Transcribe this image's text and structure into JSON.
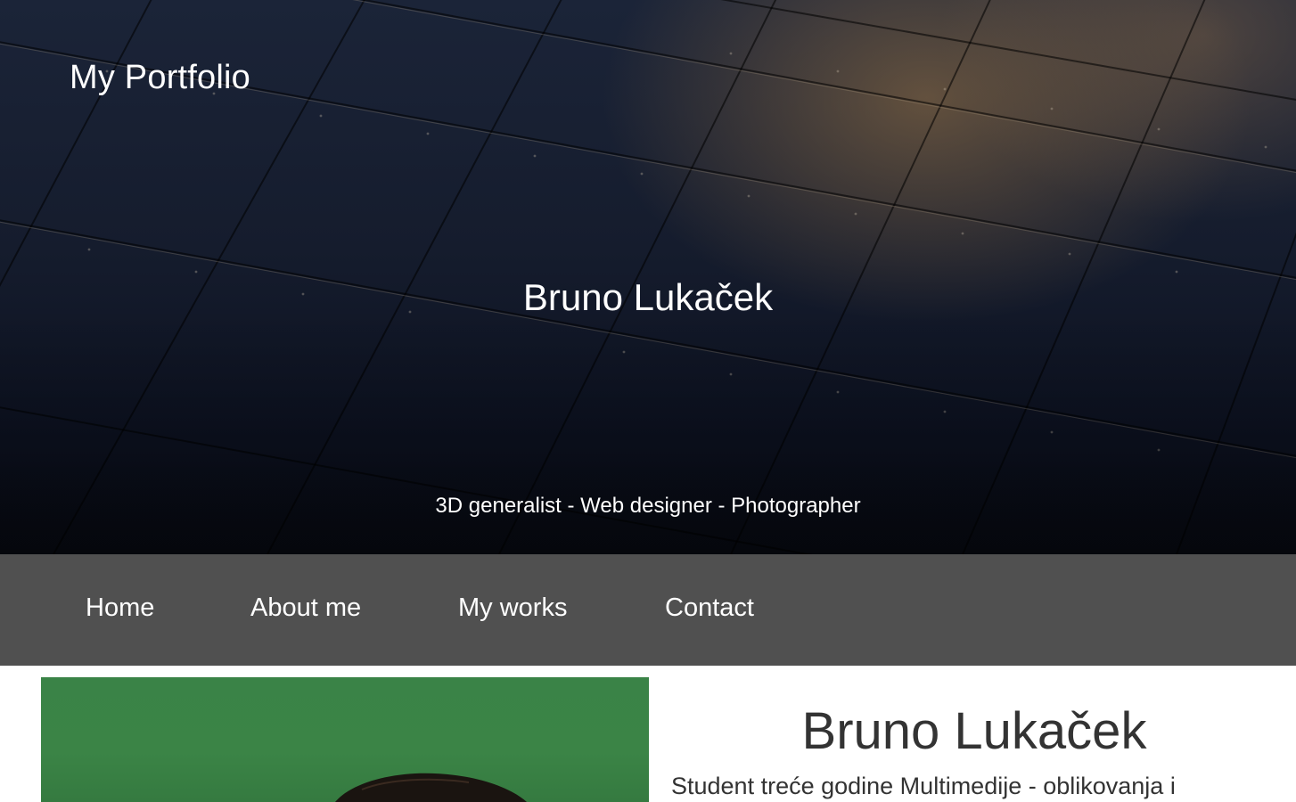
{
  "header": {
    "site_title": "My Portfolio",
    "hero_name": "Bruno Lukaček",
    "tagline": "3D generalist - Web designer - Photographer"
  },
  "nav": {
    "items": [
      {
        "label": "Home"
      },
      {
        "label": "About me"
      },
      {
        "label": "My works"
      },
      {
        "label": "Contact"
      }
    ]
  },
  "about": {
    "name": "Bruno Lukaček",
    "intro": "Student treće godine Multimedije - oblikovanja i"
  },
  "colors": {
    "nav_background": "#505050",
    "hero_dark": "#151c2d",
    "photo_background": "#3b8446",
    "text_dark": "#333333"
  }
}
